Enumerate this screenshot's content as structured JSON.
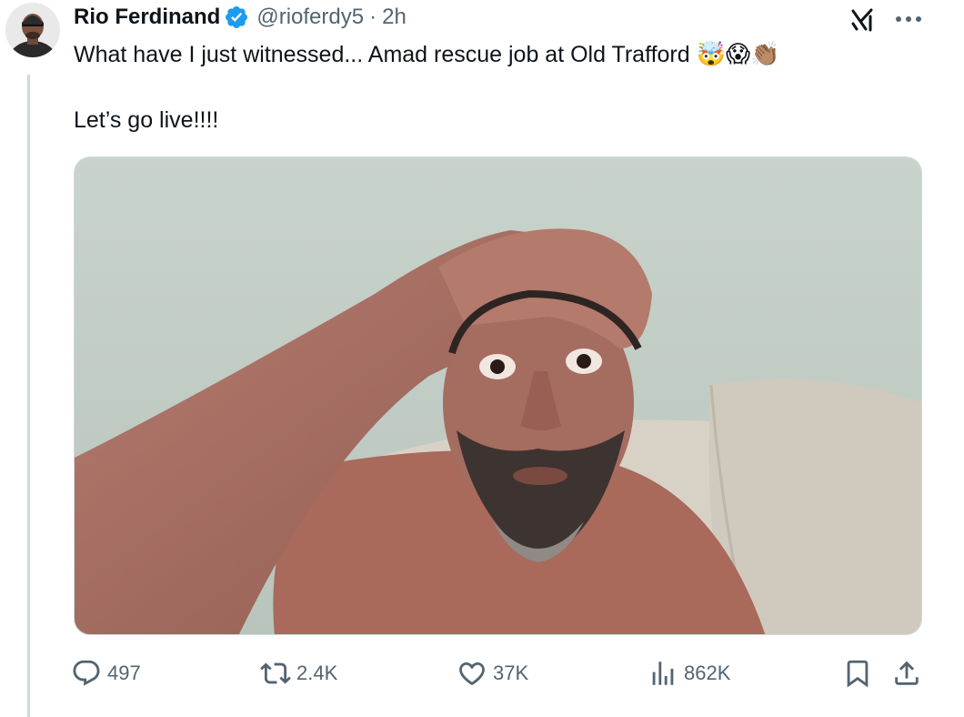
{
  "tweet": {
    "author": {
      "display_name": "Rio Ferdinand",
      "handle": "@rioferdy5",
      "verified": true,
      "avatar_icon": "avatar-photo"
    },
    "separator": "·",
    "time": "2h",
    "text_line_1": "What have I just witnessed... Amad rescue job at Old Trafford",
    "text_line_1_emojis": "🤯😱👏🏽",
    "text_line_2": "Let’s go live!!!!",
    "media": {
      "description_icon": "selfie-photo"
    }
  },
  "actions": {
    "reply_count": "497",
    "retweet_count": "2.4K",
    "like_count": "37K",
    "views_count": "862K"
  },
  "colors": {
    "text_primary": "#0f1419",
    "text_secondary": "#536471",
    "verified_blue": "#1d9bf0",
    "thread_line": "#cfd9de"
  },
  "icons": {
    "verified": "verified-badge-icon",
    "grok": "grok-icon",
    "more": "more-icon",
    "reply": "reply-icon",
    "retweet": "retweet-icon",
    "like": "heart-icon",
    "views": "views-chart-icon",
    "bookmark": "bookmark-icon",
    "share": "share-icon"
  }
}
